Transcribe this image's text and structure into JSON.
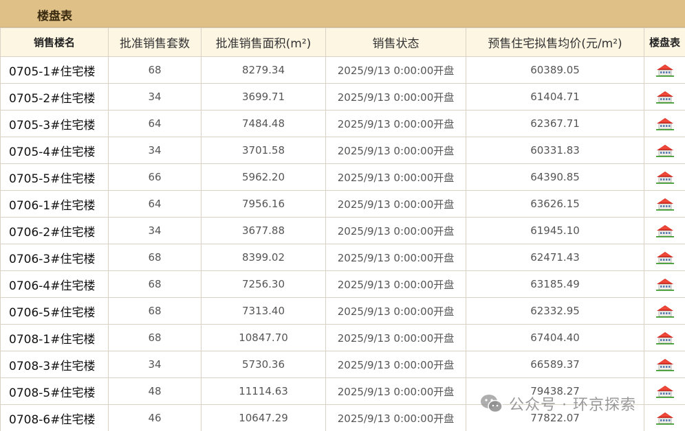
{
  "title": "楼盘表",
  "columns": {
    "name": "销售楼名",
    "units": "批准销售套数",
    "area": "批准销售面积(m²)",
    "status": "销售状态",
    "price": "预售住宅拟售均价(元/m²)",
    "plan": "楼盘表"
  },
  "rows": [
    {
      "name": "0705-1#住宅楼",
      "units": "68",
      "area": "8279.34",
      "status": "2025/9/13 0:00:00开盘",
      "price": "60389.05"
    },
    {
      "name": "0705-2#住宅楼",
      "units": "34",
      "area": "3699.71",
      "status": "2025/9/13 0:00:00开盘",
      "price": "61404.71"
    },
    {
      "name": "0705-3#住宅楼",
      "units": "64",
      "area": "7484.48",
      "status": "2025/9/13 0:00:00开盘",
      "price": "62367.71"
    },
    {
      "name": "0705-4#住宅楼",
      "units": "34",
      "area": "3701.58",
      "status": "2025/9/13 0:00:00开盘",
      "price": "60331.83"
    },
    {
      "name": "0705-5#住宅楼",
      "units": "66",
      "area": "5962.20",
      "status": "2025/9/13 0:00:00开盘",
      "price": "64390.85"
    },
    {
      "name": "0706-1#住宅楼",
      "units": "64",
      "area": "7956.16",
      "status": "2025/9/13 0:00:00开盘",
      "price": "63626.15"
    },
    {
      "name": "0706-2#住宅楼",
      "units": "34",
      "area": "3677.88",
      "status": "2025/9/13 0:00:00开盘",
      "price": "61945.10"
    },
    {
      "name": "0706-3#住宅楼",
      "units": "68",
      "area": "8399.02",
      "status": "2025/9/13 0:00:00开盘",
      "price": "62471.43"
    },
    {
      "name": "0706-4#住宅楼",
      "units": "68",
      "area": "7256.30",
      "status": "2025/9/13 0:00:00开盘",
      "price": "63185.49"
    },
    {
      "name": "0706-5#住宅楼",
      "units": "68",
      "area": "7313.40",
      "status": "2025/9/13 0:00:00开盘",
      "price": "62332.95"
    },
    {
      "name": "0708-1#住宅楼",
      "units": "68",
      "area": "10847.70",
      "status": "2025/9/13 0:00:00开盘",
      "price": "67404.40"
    },
    {
      "name": "0708-3#住宅楼",
      "units": "34",
      "area": "5730.36",
      "status": "2025/9/13 0:00:00开盘",
      "price": "66589.37"
    },
    {
      "name": "0708-5#住宅楼",
      "units": "48",
      "area": "11114.63",
      "status": "2025/9/13 0:00:00开盘",
      "price": "79438.27"
    },
    {
      "name": "0708-6#住宅楼",
      "units": "46",
      "area": "10647.29",
      "status": "2025/9/13 0:00:00开盘",
      "price": "77822.07"
    }
  ],
  "row_icon": "house-icon",
  "watermark": {
    "text": "公众号 · 环京探索",
    "icon": "wechat-icon"
  },
  "colors": {
    "title_bar": "#dfc187",
    "header_bg": "#fdf6e3",
    "border": "#d9d2c4",
    "house_roof": "#d9261c"
  }
}
